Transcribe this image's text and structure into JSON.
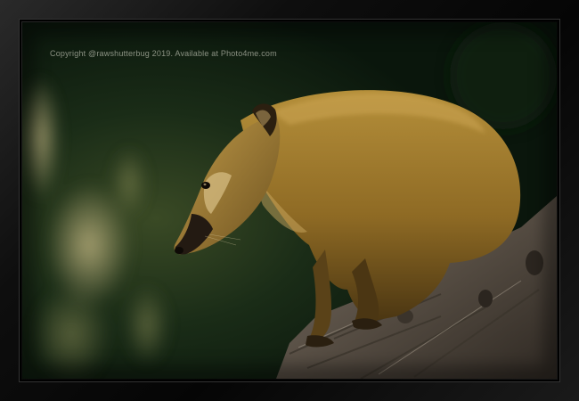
{
  "watermark": {
    "text": "Copyright @rawshutterbug  2019. Available at Photo4me.com"
  },
  "photo": {
    "subject": "coati",
    "colors": {
      "background_dark": "#0b1a0e",
      "fur": "#a9842f",
      "bark": "#5a5147",
      "frame": "#0a0a0a"
    }
  }
}
